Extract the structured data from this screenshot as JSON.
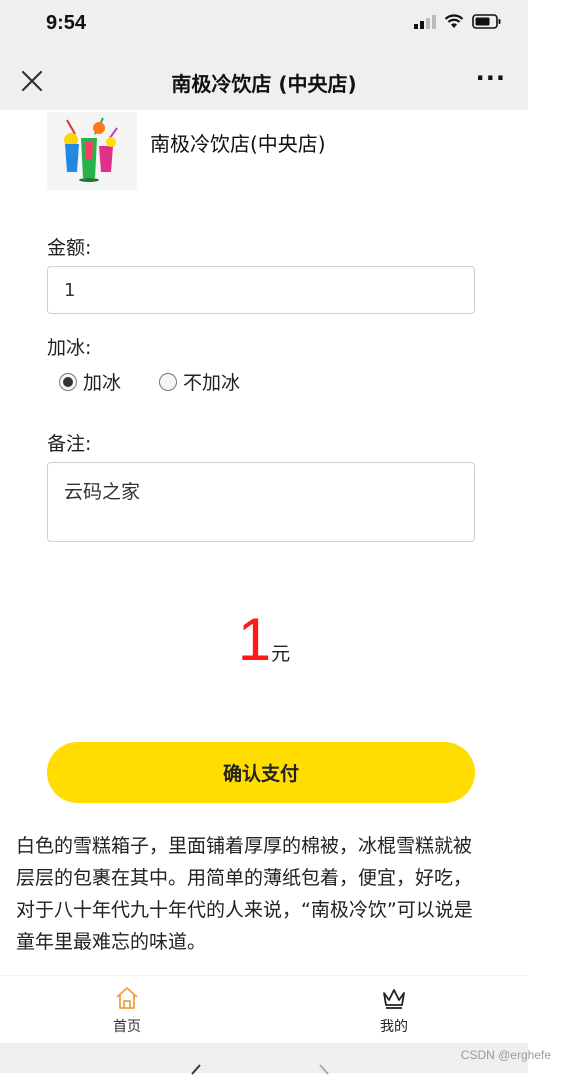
{
  "status_bar": {
    "time": "9:54",
    "icons": [
      "signal-icon",
      "wifi-icon",
      "battery-icon"
    ]
  },
  "nav": {
    "title": "南极冷饮店 (中央店)",
    "close_icon": "close-icon",
    "more_label": "···"
  },
  "shop": {
    "name": "南极冷饮店(中央店)",
    "logo_icon": "cocktail-drinks-icon"
  },
  "form": {
    "amount_label": "金额:",
    "amount_value": "1",
    "ice_label": "加冰:",
    "ice_options": [
      {
        "label": "加冰",
        "selected": true
      },
      {
        "label": "不加冰",
        "selected": false
      }
    ],
    "remark_label": "备注:",
    "remark_value": "云码之家"
  },
  "price": {
    "value": "1",
    "unit": "元"
  },
  "pay_button_label": "确认支付",
  "description": [
    "白色的雪糕箱子，里面铺着厚厚的棉被，冰棍雪糕就被",
    "层层的包裹在其中。用简单的薄纸包着，便宜，好吃，",
    "对于八十年代九十年代的人来说，“南极冷饮”可以说是",
    "童年里最难忘的味道。"
  ],
  "tabs": [
    {
      "label": "首页",
      "icon": "home-icon",
      "active": true
    },
    {
      "label": "我的",
      "icon": "crown-icon",
      "active": false
    }
  ],
  "watermark": "CSDN @erghefe",
  "colors": {
    "accent_yellow": "#ffdd00",
    "price_red": "#ff1a1a",
    "home_icon_orange": "#f0a040",
    "bar_gray": "#efefef"
  }
}
